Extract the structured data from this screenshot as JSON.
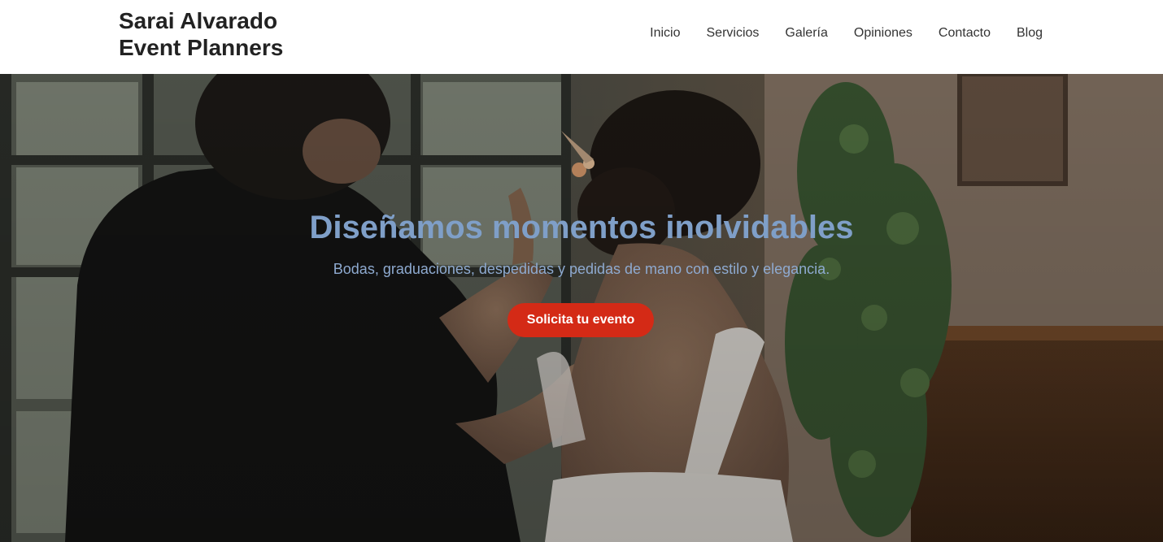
{
  "brand": {
    "line1": "Sarai Alvarado",
    "line2": "Event Planners"
  },
  "nav": {
    "items": [
      {
        "label": "Inicio"
      },
      {
        "label": "Servicios"
      },
      {
        "label": "Galería"
      },
      {
        "label": "Opiniones"
      },
      {
        "label": "Contacto"
      },
      {
        "label": "Blog"
      }
    ]
  },
  "hero": {
    "title": "Diseñamos momentos inolvidables",
    "subtitle": "Bodas, graduaciones, despedidas y pedidas de mano con estilo y elegancia.",
    "cta_label": "Solicita tu evento"
  },
  "colors": {
    "accent": "#d42a16",
    "title": "#7f9fc8",
    "header_bg": "#ffffff"
  }
}
